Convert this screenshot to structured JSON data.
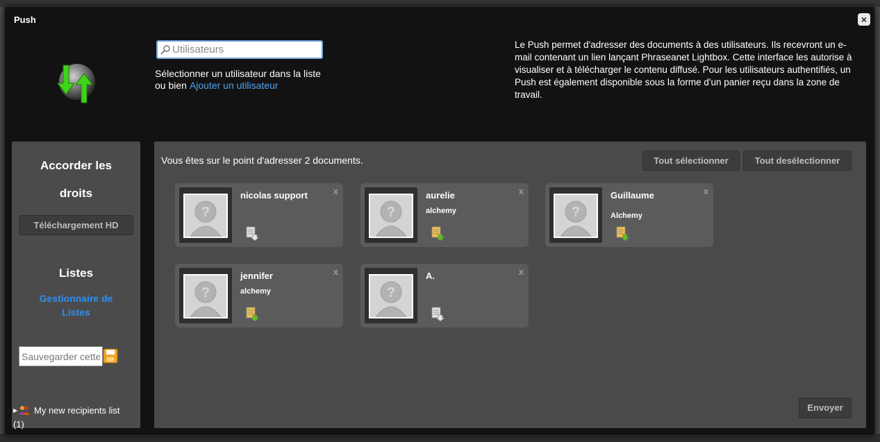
{
  "dialog": {
    "title": "Push",
    "close_label": "×"
  },
  "search": {
    "placeholder": "Utilisateurs",
    "value": ""
  },
  "hint": {
    "text": "Sélectionner un utilisateur dans la liste",
    "prefix": "ou bien",
    "link": "Ajouter un utilisateur"
  },
  "info": "Le Push permet d'adresser des documents à des utilisateurs. Ils recevront un e-mail contenant un lien lançant Phraseanet Lightbox. Cette interface les autorise à visualiser et à télécharger le contenu diffusé. Pour les utilisateurs authentifiés, un Push est également disponible sous la forme d'un panier reçu dans la zone de travail.",
  "sidebar": {
    "rights_title_line1": "Accorder les",
    "rights_title_line2": "droits",
    "hd_button": "Téléchargement HD",
    "lists_title": "Listes",
    "manager_link": "Gestionnaire de Listes",
    "save_placeholder": "Sauvegarder cette liste",
    "list_item": "My new recipients list (1)"
  },
  "main": {
    "summary": "Vous êtes sur le point d'adresser 2 documents.",
    "select_all": "Tout sélectionner",
    "deselect_all": "Tout desélectionner",
    "send": "Envoyer"
  },
  "recipients": [
    {
      "name": "nicolas support",
      "company": "",
      "download_enabled": false
    },
    {
      "name": "aurelie",
      "company": "alchemy",
      "download_enabled": true
    },
    {
      "name": "Guillaume",
      "company": "Alchemy",
      "download_enabled": true
    },
    {
      "name": "jennifer",
      "company": "alchemy",
      "download_enabled": true
    },
    {
      "name": "A.",
      "company": "",
      "download_enabled": false
    }
  ],
  "colors": {
    "accent_link": "#4fa3f0",
    "manager_link": "#2e8ff0",
    "card_bg": "#5b5b5b"
  }
}
